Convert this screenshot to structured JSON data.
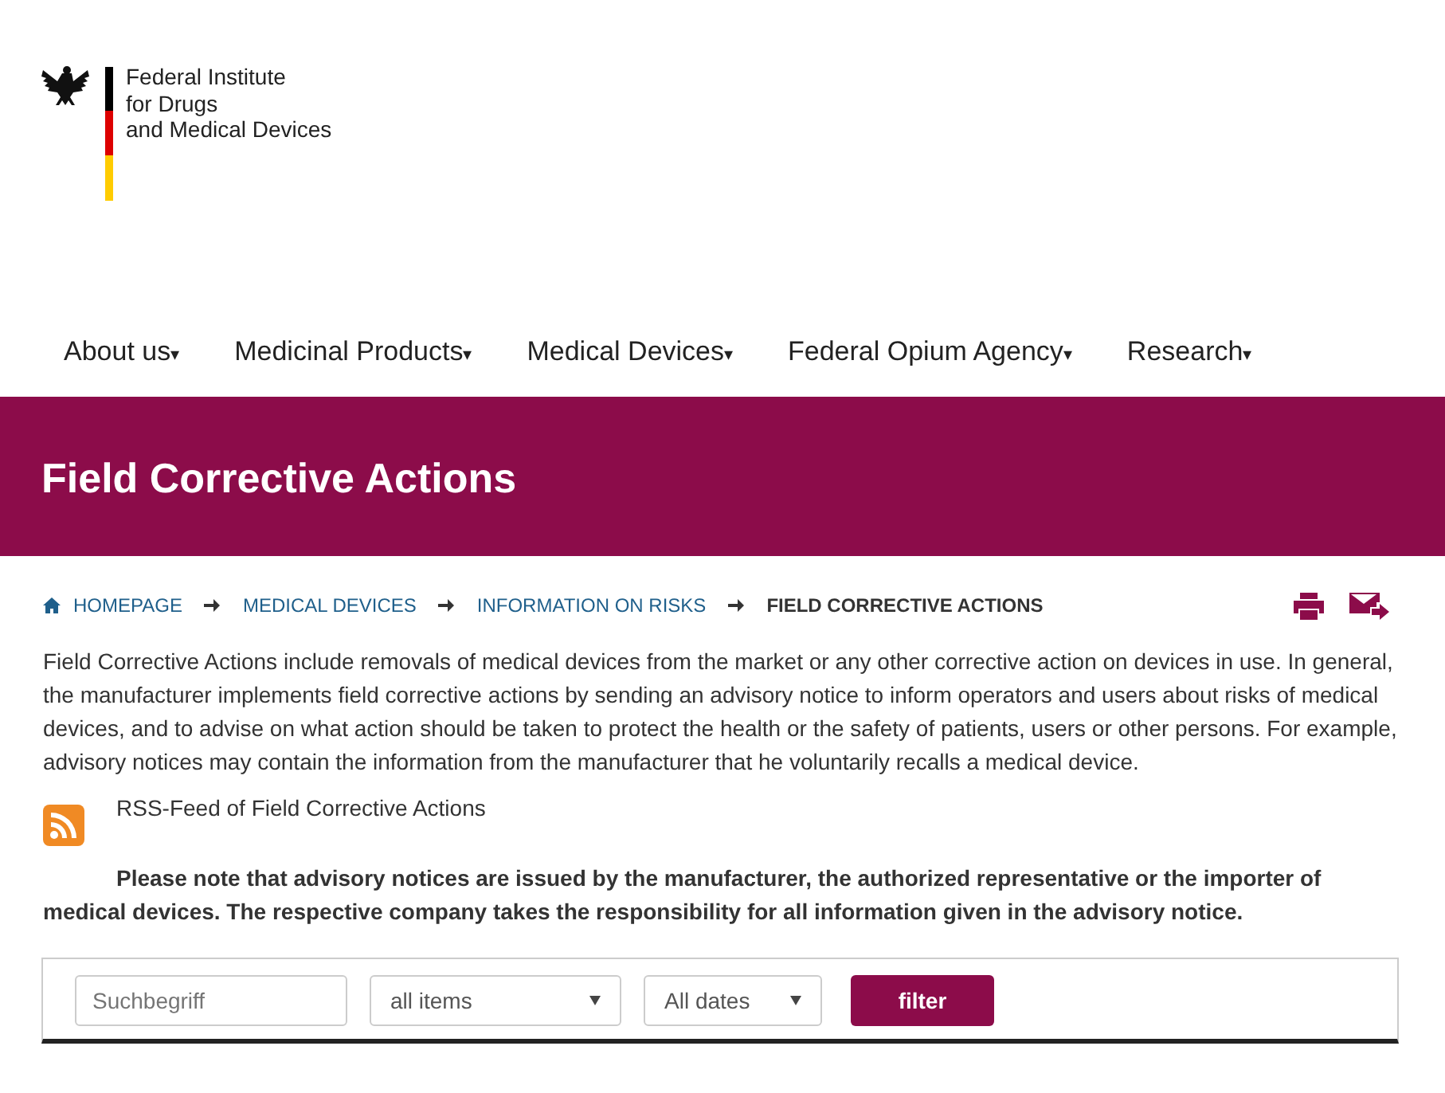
{
  "logo": {
    "lines": [
      "Federal Institute",
      "for Drugs",
      "and Medical Devices"
    ]
  },
  "nav": [
    {
      "label": "About us",
      "caret": "▾"
    },
    {
      "label": "Medicinal Products",
      "caret": "▾"
    },
    {
      "label": "Medical Devices",
      "caret": "▾"
    },
    {
      "label": "Federal Opium Agency",
      "caret": "▾"
    },
    {
      "label": "Research",
      "caret": "▾"
    }
  ],
  "page_title": "Field Corrective Actions",
  "breadcrumb": [
    {
      "label": "HOMEPAGE",
      "current": false
    },
    {
      "label": "MEDICAL DEVICES",
      "current": false
    },
    {
      "label": "INFORMATION ON RISKS",
      "current": false
    },
    {
      "label": "FIELD CORRECTIVE ACTIONS",
      "current": true
    }
  ],
  "intro": "Field Corrective Actions include removals of medical devices from the market or any other corrective action on devices in use. In general, the manufacturer implements field corrective actions by sending an advisory notice to inform operators and users about risks of medical devices, and to advise on what action should be taken to protect the health or the safety of patients, users or other persons. For example, advisory notices may contain the information from the manufacturer that he voluntarily recalls a medical device.",
  "rss_link": "RSS-Feed of Field Corrective Actions",
  "note": "Please note that advisory notices are issued by the manufacturer, the authorized representative or the importer of medical devices. The respective company takes the responsibility for all information given in the advisory notice.",
  "filter": {
    "search": {
      "placeholder": "Suchbegriff"
    },
    "type_select": "all items",
    "date_select": "All dates",
    "button": "filter"
  }
}
